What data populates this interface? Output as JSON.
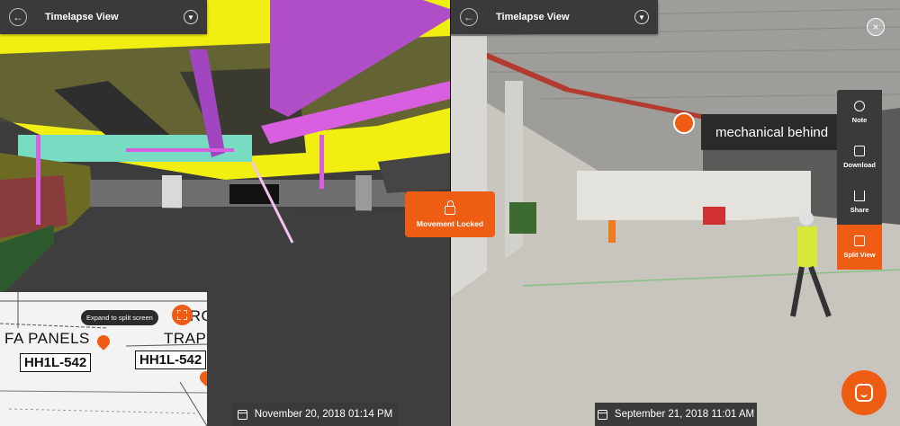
{
  "left_view": {
    "title": "Timelapse View",
    "date": "November 20, 2018 01:14 PM",
    "movement_locked_label": "Movement Locked"
  },
  "right_view": {
    "title": "Timelapse View",
    "date": "September 21, 2018 11:01 AM",
    "note_text": "mechanical behind",
    "toolbar": [
      {
        "label": "Note",
        "icon": "note-plus-icon"
      },
      {
        "label": "Download",
        "icon": "download-icon"
      },
      {
        "label": "Share",
        "icon": "share-icon"
      },
      {
        "label": "Split View",
        "icon": "split-view-icon",
        "active": true
      }
    ]
  },
  "floorplan": {
    "expand_tip": "Expand to split screen",
    "labels": [
      "FA PANELS",
      "TRAP",
      "CROSS",
      "HH1L-542",
      "HH1L-542"
    ]
  },
  "colors": {
    "accent": "#ef5d15",
    "bar": "#3a3a3a"
  }
}
